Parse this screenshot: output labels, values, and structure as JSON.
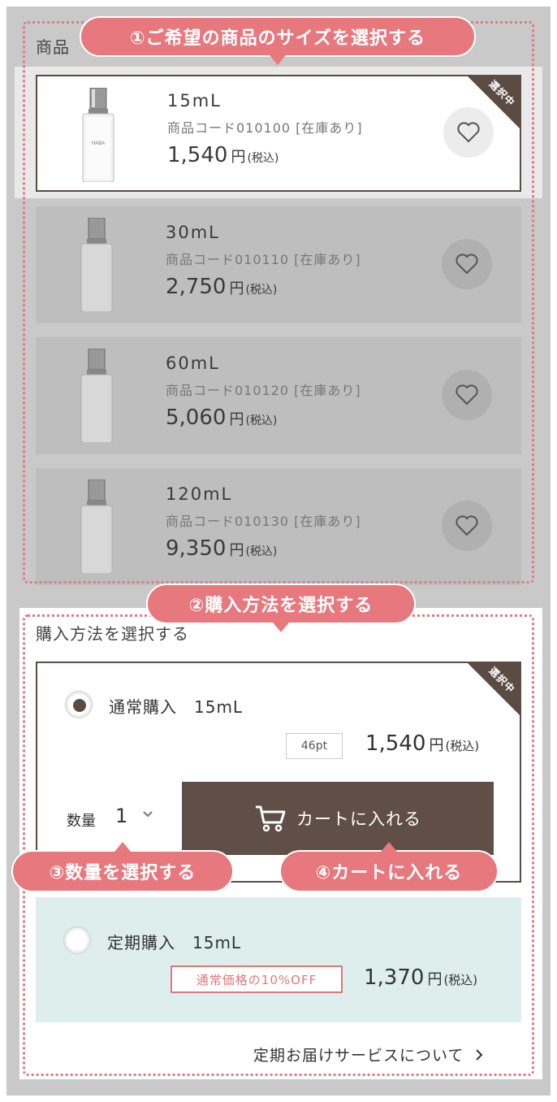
{
  "sections": {
    "products_label": "商品",
    "purchase_label": "購入方法を選択する"
  },
  "callouts": {
    "step1": "①ご希望の商品のサイズを選択する",
    "step2": "②購入方法を選択する",
    "step3": "③数量を選択する",
    "step4": "④カートに入れる"
  },
  "selected_badge": "選択中",
  "products": [
    {
      "size": "15mL",
      "code": "商品コード010100 [在庫あり]",
      "price": "1,540",
      "yen": "円",
      "tax": "(税込)",
      "selected": true
    },
    {
      "size": "30mL",
      "code": "商品コード010110 [在庫あり]",
      "price": "2,750",
      "yen": "円",
      "tax": "(税込)",
      "selected": false
    },
    {
      "size": "60mL",
      "code": "商品コード010120 [在庫あり]",
      "price": "5,060",
      "yen": "円",
      "tax": "(税込)",
      "selected": false
    },
    {
      "size": "120mL",
      "code": "商品コード010130 [在庫あり]",
      "price": "9,350",
      "yen": "円",
      "tax": "(税込)",
      "selected": false
    }
  ],
  "bottle_label": {
    "brand": "SQUALANE",
    "maker": "HABA"
  },
  "normal_purchase": {
    "title": "通常購入　15mL",
    "points": "46pt",
    "price": "1,540",
    "yen": "円",
    "tax": "(税込)",
    "qty_label": "数量",
    "qty_value": "1",
    "cart_button": "カートに入れる"
  },
  "subscription": {
    "title": "定期購入　15mL",
    "discount": "通常価格の10%OFF",
    "price": "1,370",
    "yen": "円",
    "tax": "(税込)"
  },
  "delivery_link": "定期お届けサービスについて",
  "colors": {
    "accent_pink": "#e6787e",
    "brown": "#5a4b43",
    "mint": "#ddeeed"
  }
}
